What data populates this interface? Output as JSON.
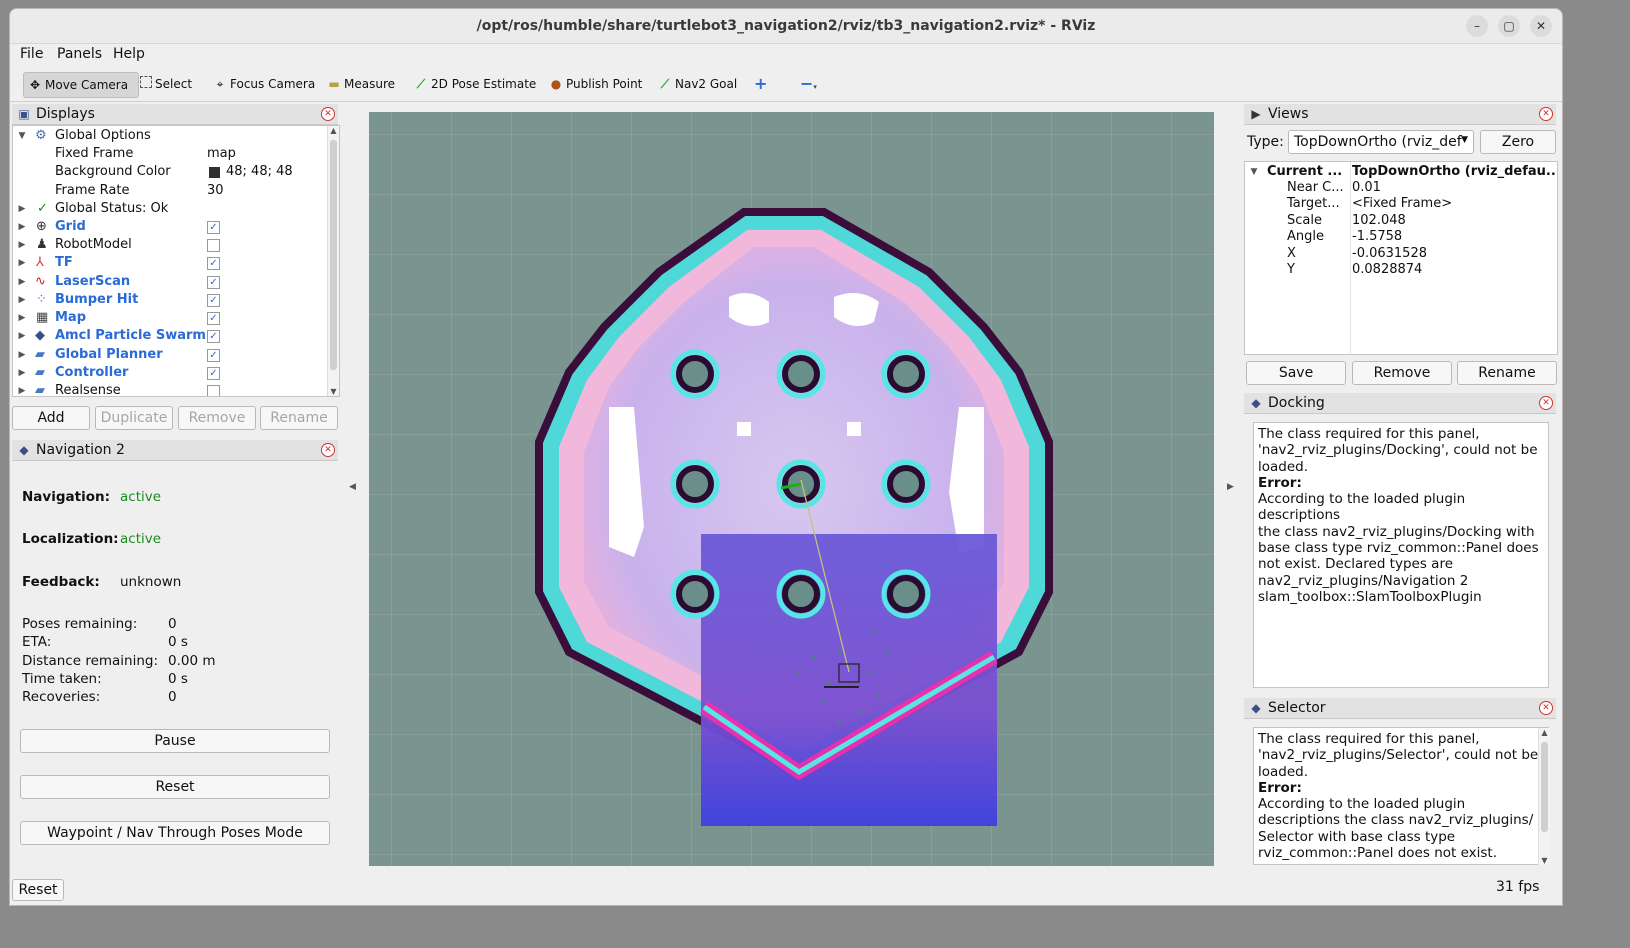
{
  "window": {
    "title": "/opt/ros/humble/share/turtlebot3_navigation2/rviz/tb3_navigation2.rviz* - RViz",
    "controls": [
      "–",
      "▢",
      "✕"
    ]
  },
  "menu": [
    "File",
    "Panels",
    "Help"
  ],
  "toolbar": [
    {
      "label": "Move Camera",
      "icon": "move-camera-icon",
      "active": true
    },
    {
      "label": "Select",
      "icon": "select-icon"
    },
    {
      "label": "Focus Camera",
      "icon": "focus-camera-icon"
    },
    {
      "label": "Measure",
      "icon": "measure-icon"
    },
    {
      "label": "2D Pose Estimate",
      "icon": "pose-estimate-icon"
    },
    {
      "label": "Publish Point",
      "icon": "publish-point-icon"
    },
    {
      "label": "Nav2 Goal",
      "icon": "nav2-goal-icon"
    },
    {
      "label": "",
      "icon": "plus-icon"
    },
    {
      "label": "",
      "icon": "minus-icon"
    }
  ],
  "displays": {
    "title": "Displays",
    "global_options": "Global Options",
    "properties": [
      {
        "name": "Fixed Frame",
        "value": "map"
      },
      {
        "name": "Background Color",
        "value": "48; 48; 48",
        "swatch": "#303030"
      },
      {
        "name": "Frame Rate",
        "value": "30"
      }
    ],
    "global_status": "Global Status: Ok",
    "items": [
      {
        "name": "Grid",
        "checked": true,
        "highlight": true
      },
      {
        "name": "RobotModel",
        "checked": false,
        "highlight": false
      },
      {
        "name": "TF",
        "checked": true,
        "highlight": true
      },
      {
        "name": "LaserScan",
        "checked": true,
        "highlight": true
      },
      {
        "name": "Bumper Hit",
        "checked": true,
        "highlight": true
      },
      {
        "name": "Map",
        "checked": true,
        "highlight": true
      },
      {
        "name": "Amcl Particle Swarm",
        "checked": true,
        "highlight": true
      },
      {
        "name": "Global Planner",
        "checked": true,
        "highlight": true
      },
      {
        "name": "Controller",
        "checked": true,
        "highlight": true
      },
      {
        "name": "Realsense",
        "checked": false,
        "highlight": false
      }
    ],
    "buttons": {
      "add": "Add",
      "duplicate": "Duplicate",
      "remove": "Remove",
      "rename": "Rename"
    }
  },
  "navigation": {
    "title": "Navigation 2",
    "navigation_label": "Navigation:",
    "navigation_value": "active",
    "localization_label": "Localization:",
    "localization_value": "active",
    "feedback_label": "Feedback:",
    "feedback_value": "unknown",
    "stats": [
      {
        "label": "Poses remaining:",
        "value": "0"
      },
      {
        "label": "ETA:",
        "value": "0 s"
      },
      {
        "label": "Distance remaining:",
        "value": "0.00 m"
      },
      {
        "label": "Time taken:",
        "value": "0 s"
      },
      {
        "label": "Recoveries:",
        "value": "0"
      }
    ],
    "buttons": {
      "pause": "Pause",
      "reset": "Reset",
      "waypoint": "Waypoint / Nav Through Poses Mode"
    }
  },
  "views": {
    "title": "Views",
    "type_label": "Type:",
    "type_value": "TopDownOrtho (rviz_def",
    "zero": "Zero",
    "current_name": "Current ...",
    "current_value": "TopDownOrtho (rviz_defau...",
    "props": [
      {
        "name": "Near C...",
        "value": "0.01"
      },
      {
        "name": "Target...",
        "value": "<Fixed Frame>"
      },
      {
        "name": "Scale",
        "value": "102.048"
      },
      {
        "name": "Angle",
        "value": "-1.5758"
      },
      {
        "name": "X",
        "value": "-0.0631528"
      },
      {
        "name": "Y",
        "value": "0.0828874"
      }
    ],
    "buttons": {
      "save": "Save",
      "remove": "Remove",
      "rename": "Rename"
    }
  },
  "docking": {
    "title": "Docking",
    "line1": "The class required for this panel,",
    "line2": "'nav2_rviz_plugins/Docking', could not be",
    "line3": "loaded.",
    "error": "Error:",
    "lines": [
      "According to the loaded plugin descriptions",
      "the class nav2_rviz_plugins/Docking with",
      "base class type rviz_common::Panel does",
      "not exist. Declared types are",
      "nav2_rviz_plugins/Navigation 2",
      "slam_toolbox::SlamToolboxPlugin"
    ]
  },
  "selector": {
    "title": "Selector",
    "line1": "The class required for this panel,",
    "line2": "'nav2_rviz_plugins/Selector', could not be",
    "line3": "loaded.",
    "error": "Error:",
    "lines": [
      "According to the loaded plugin",
      "descriptions the class nav2_rviz_plugins/",
      "Selector with base class type",
      "rviz_common::Panel does not exist."
    ]
  },
  "status": {
    "reset": "Reset",
    "fps": "31 fps"
  }
}
